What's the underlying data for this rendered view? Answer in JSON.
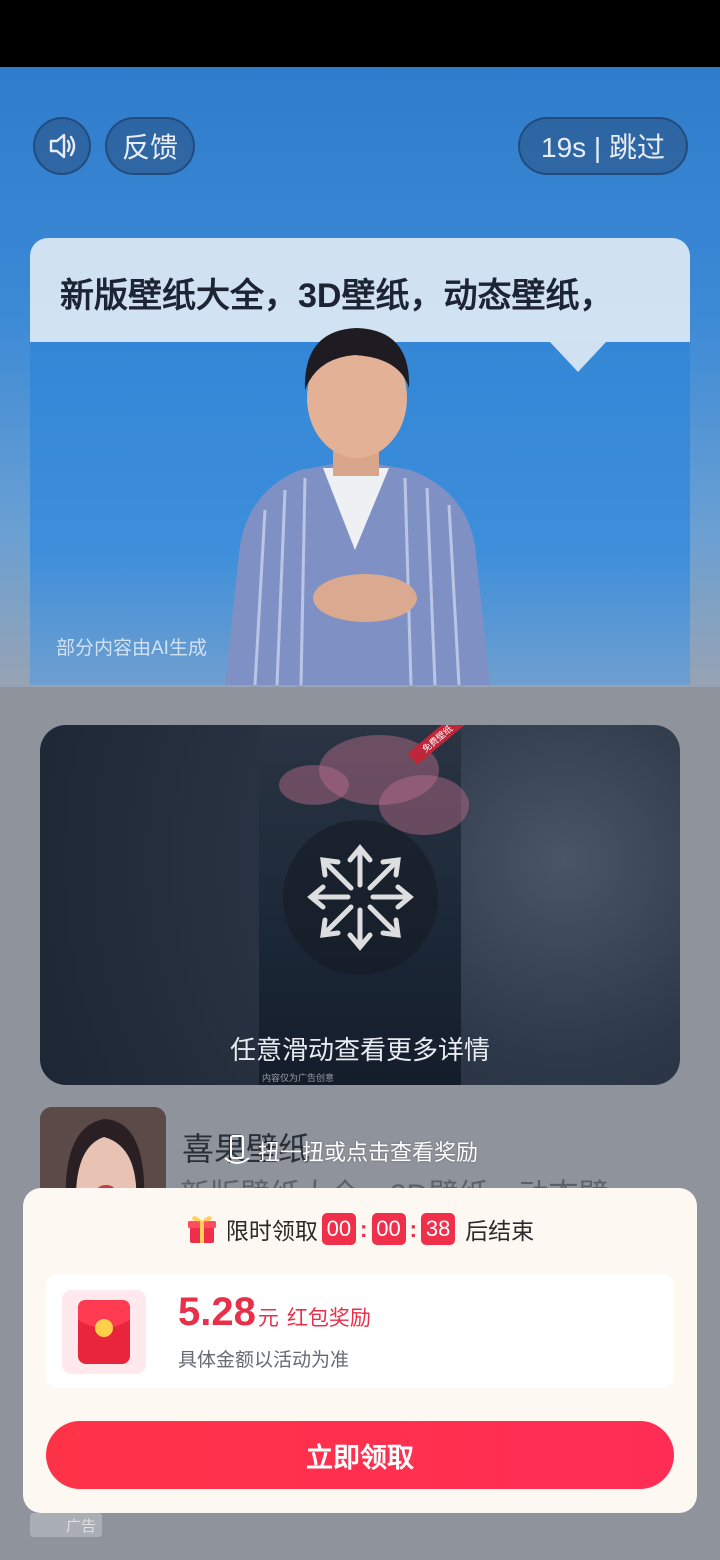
{
  "top_controls": {
    "feedback_label": "反馈",
    "skip_label": "19s | 跳过"
  },
  "headline": "新版壁纸大全，3D壁纸，动态壁纸，",
  "ai_note": "部分内容由AI生成",
  "swipe_card": {
    "hint": "任意滑动查看更多详情",
    "preview_tag": "免费壁纸",
    "preview_caption": "内容仅为广告创意"
  },
  "app": {
    "name": "喜果壁纸",
    "description": "新版壁纸大全，3D壁纸，动态壁",
    "twist_hint": "扭一扭或点击查看奖励"
  },
  "reward": {
    "timer_prefix": "限时领取",
    "timer_hours": "00",
    "timer_minutes": "00",
    "timer_seconds": "38",
    "timer_suffix": "后结束",
    "amount": "5.28",
    "unit": "元",
    "label": "红包奖励",
    "note": "具体金额以活动为准",
    "claim_button": "立即领取"
  },
  "ad_badge": "广告",
  "colors": {
    "accent_red": "#f0304a",
    "sky_blue": "#2f7ccc"
  },
  "icons": [
    "speaker-icon",
    "gift-icon",
    "red-envelope-icon",
    "swipe-arrows-icon",
    "phone-shake-icon"
  ]
}
